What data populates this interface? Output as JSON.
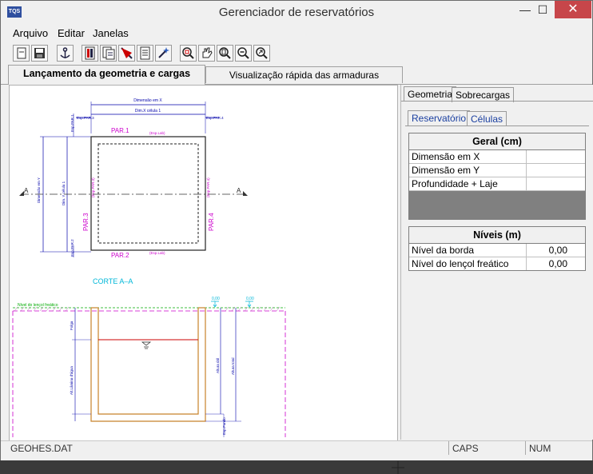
{
  "window": {
    "title": "Gerenciador de reservatórios",
    "icon_label": "TQS",
    "minimize": "—",
    "maximize": "☐",
    "close": "✕"
  },
  "menu": {
    "items": [
      {
        "label": "Arquivo"
      },
      {
        "label": "Editar"
      },
      {
        "label": "Janelas"
      }
    ]
  },
  "toolbar": {
    "buttons": [
      "new-icon",
      "save-icon",
      "anchor-icon",
      "page-red-icon",
      "page-copy-icon",
      "flag-icon",
      "document-icon",
      "sparkle-icon",
      "zoom-window-icon",
      "pan-hand-icon",
      "zoom-fit-icon",
      "zoom-out-icon",
      "zoom-previous-icon"
    ]
  },
  "tabs": {
    "active": "Lançamento da geometria e cargas",
    "inactive": "Visualização rápida das armaduras"
  },
  "drawing": {
    "dim_x": "Dimensão em X",
    "dim_x_cell": "Dim.X célula 1",
    "dim_y": "Dimensão em Y",
    "dim_y_cell": "Dim. Y célula 1",
    "esp_par3": "Esp.PAR.3",
    "esp_par4": "Esp.PAR.4",
    "esp_par1": "Esp.PAR.1",
    "esp_par2": "Esp.PAR.2",
    "par1": "PAR.1",
    "par2": "PAR.2",
    "par3": "PAR.3",
    "par4": "PAR.4",
    "esp_lab": "(Esp.Lab)",
    "esp_lab_top": "(Esp.Lab)",
    "esp_par_left": "(Esp.PAR.3)",
    "esp_par_right": "(Esp.PAR.4)",
    "section_mark": "A",
    "corte": "CORTE A–A",
    "nivel_lencol": "Nível do lençol freático",
    "folga": "Folga",
    "alt_lamina": "Alt.Lâmina d'água",
    "altura_util": "Altura útil",
    "altura_total": "Altura total",
    "esp_fundo": "Esp.Fundo",
    "level_a": "0,00",
    "level_b": "0,00"
  },
  "right_panel": {
    "tab_geometria": "Geometria",
    "tab_sobrecargas": "Sobrecargas",
    "subtab_reservatorio": "Reservatório",
    "subtab_celulas": "Células",
    "geral": {
      "header": "Geral (cm)",
      "rows": [
        {
          "label": "Dimensão em X",
          "value": ""
        },
        {
          "label": "Dimensão em Y",
          "value": ""
        },
        {
          "label": "Profundidade + Laje",
          "value": ""
        }
      ]
    },
    "niveis": {
      "header": "Níveis (m)",
      "rows": [
        {
          "label": "Nível da borda",
          "value": "0,00"
        },
        {
          "label": "Nível do lençol freático",
          "value": "0,00"
        }
      ]
    }
  },
  "status": {
    "file": "GEOHES.DAT",
    "caps": "CAPS",
    "num": "NUM"
  },
  "colors": {
    "magenta": "#cc00cc",
    "blue_dim": "#0000aa",
    "cyan": "#00b7d8",
    "green": "#00aa00",
    "orange": "#c8822a",
    "red": "#cc0000"
  }
}
